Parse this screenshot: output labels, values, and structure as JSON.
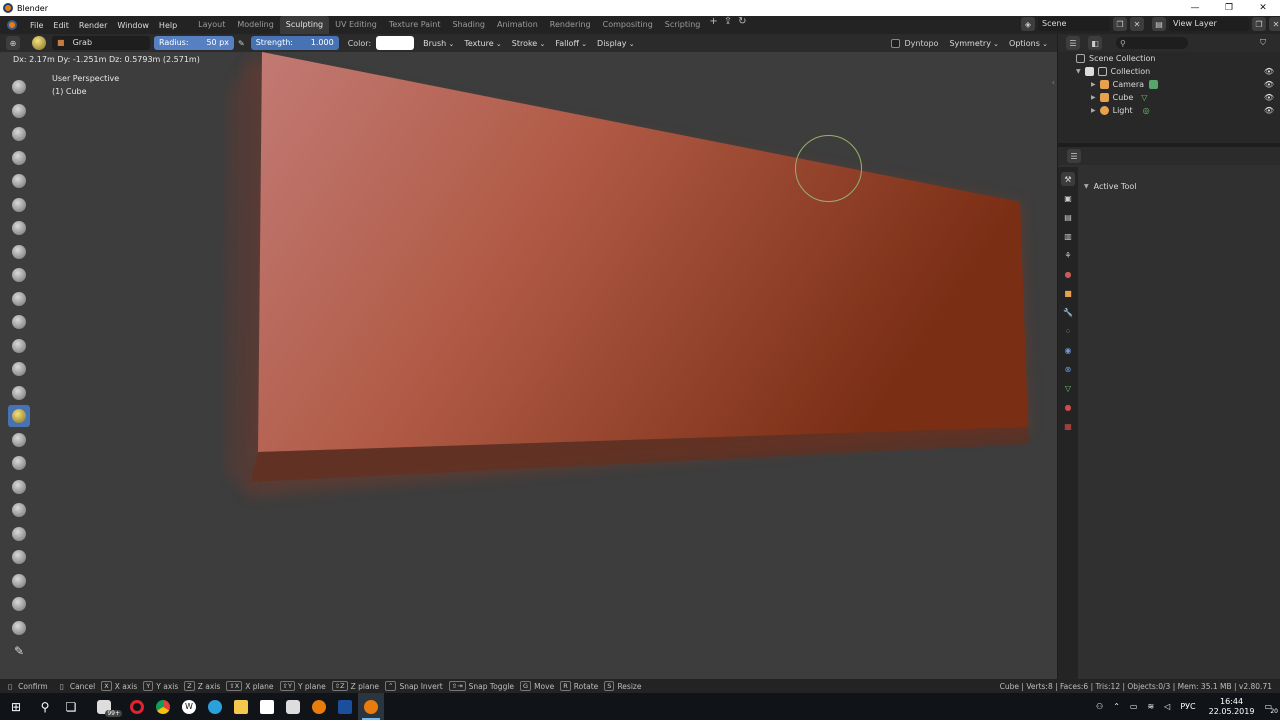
{
  "window": {
    "title": "Blender",
    "controls": [
      "—",
      "❐",
      "✕"
    ]
  },
  "menu": [
    "File",
    "Edit",
    "Render",
    "Window",
    "Help"
  ],
  "workspaces": [
    "Layout",
    "Modeling",
    "Sculpting",
    "UV Editing",
    "Texture Paint",
    "Shading",
    "Animation",
    "Rendering",
    "Compositing",
    "Scripting"
  ],
  "workspace_active": "Sculpting",
  "workspace_add": "+",
  "scene": {
    "name": "Scene",
    "view_layer": "View Layer"
  },
  "tool_header": {
    "brush_name": "Grab",
    "radius_label": "Radius:",
    "radius_value": "50 px",
    "strength_label": "Strength:",
    "strength_value": "1.000",
    "color_label": "Color:",
    "menus": [
      "Brush",
      "Texture",
      "Stroke",
      "Falloff",
      "Display"
    ],
    "dyntopo": "Dyntopo",
    "symmetry": "Symmetry",
    "options": "Options"
  },
  "viewport": {
    "transform_info": "Dx: 2.17m   Dy: -1.251m   Dz: 0.5793m (2.571m)",
    "perspective": "User Perspective",
    "object": "(1) Cube"
  },
  "outliner": {
    "root": "Scene Collection",
    "collection": "Collection",
    "items": [
      "Camera",
      "Cube",
      "Light"
    ]
  },
  "properties": {
    "section": "Active Tool"
  },
  "status": {
    "hints": [
      {
        "key": "",
        "label": "Confirm"
      },
      {
        "key": "",
        "label": "Cancel"
      },
      {
        "key": "X",
        "label": "X axis"
      },
      {
        "key": "Y",
        "label": "Y axis"
      },
      {
        "key": "Z",
        "label": "Z axis"
      },
      {
        "key": "⇧X",
        "label": "X plane"
      },
      {
        "key": "⇧Y",
        "label": "Y plane"
      },
      {
        "key": "⇧Z",
        "label": "Z plane"
      },
      {
        "key": "⌃",
        "label": "Snap Invert"
      },
      {
        "key": "⇧⇥",
        "label": "Snap Toggle"
      },
      {
        "key": "G",
        "label": "Move"
      },
      {
        "key": "R",
        "label": "Rotate"
      },
      {
        "key": "S",
        "label": "Resize"
      }
    ],
    "stats": "Cube | Verts:8 | Faces:6 | Tris:12 | Objects:0/3 | Mem: 35.1 MB | v2.80.71"
  },
  "taskbar": {
    "badge": "99+",
    "lang": "РУС",
    "time": "16:44",
    "date": "22.05.2019",
    "notifications": "20"
  },
  "colors": {
    "accent": "#4772b3",
    "mesh": "#b5503a",
    "cursor": "#97b06a"
  }
}
